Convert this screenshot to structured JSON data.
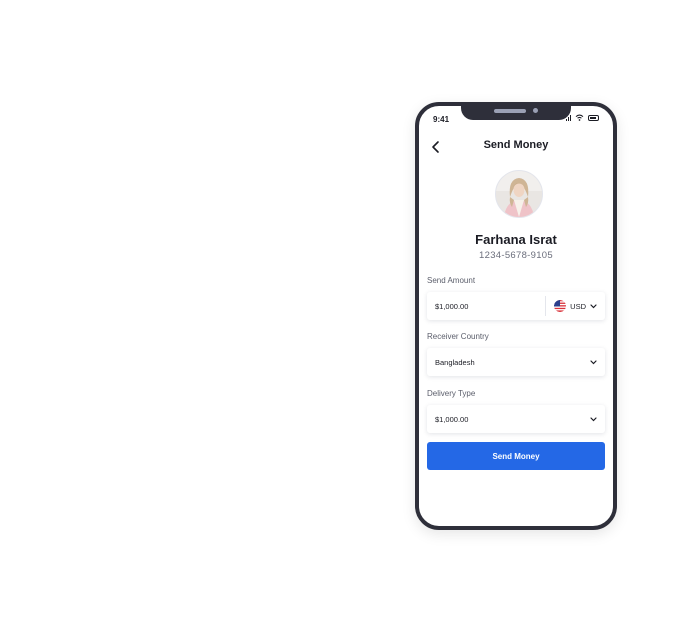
{
  "status_bar": {
    "time": "9:41"
  },
  "header": {
    "title": "Send Money"
  },
  "recipient": {
    "name": "Farhana Israt",
    "account": "1234-5678-9105"
  },
  "send_amount": {
    "label": "Send Amount",
    "value": "$1,000.00",
    "currency": "USD"
  },
  "receiver_country": {
    "label": "Receiver Country",
    "value": "Bangladesh"
  },
  "delivery_type": {
    "label": "Delivery Type",
    "value": "$1,000.00"
  },
  "primary_action": {
    "label": "Send Money"
  },
  "colors": {
    "accent": "#2468e6",
    "device_frame": "#2e2f3a"
  }
}
